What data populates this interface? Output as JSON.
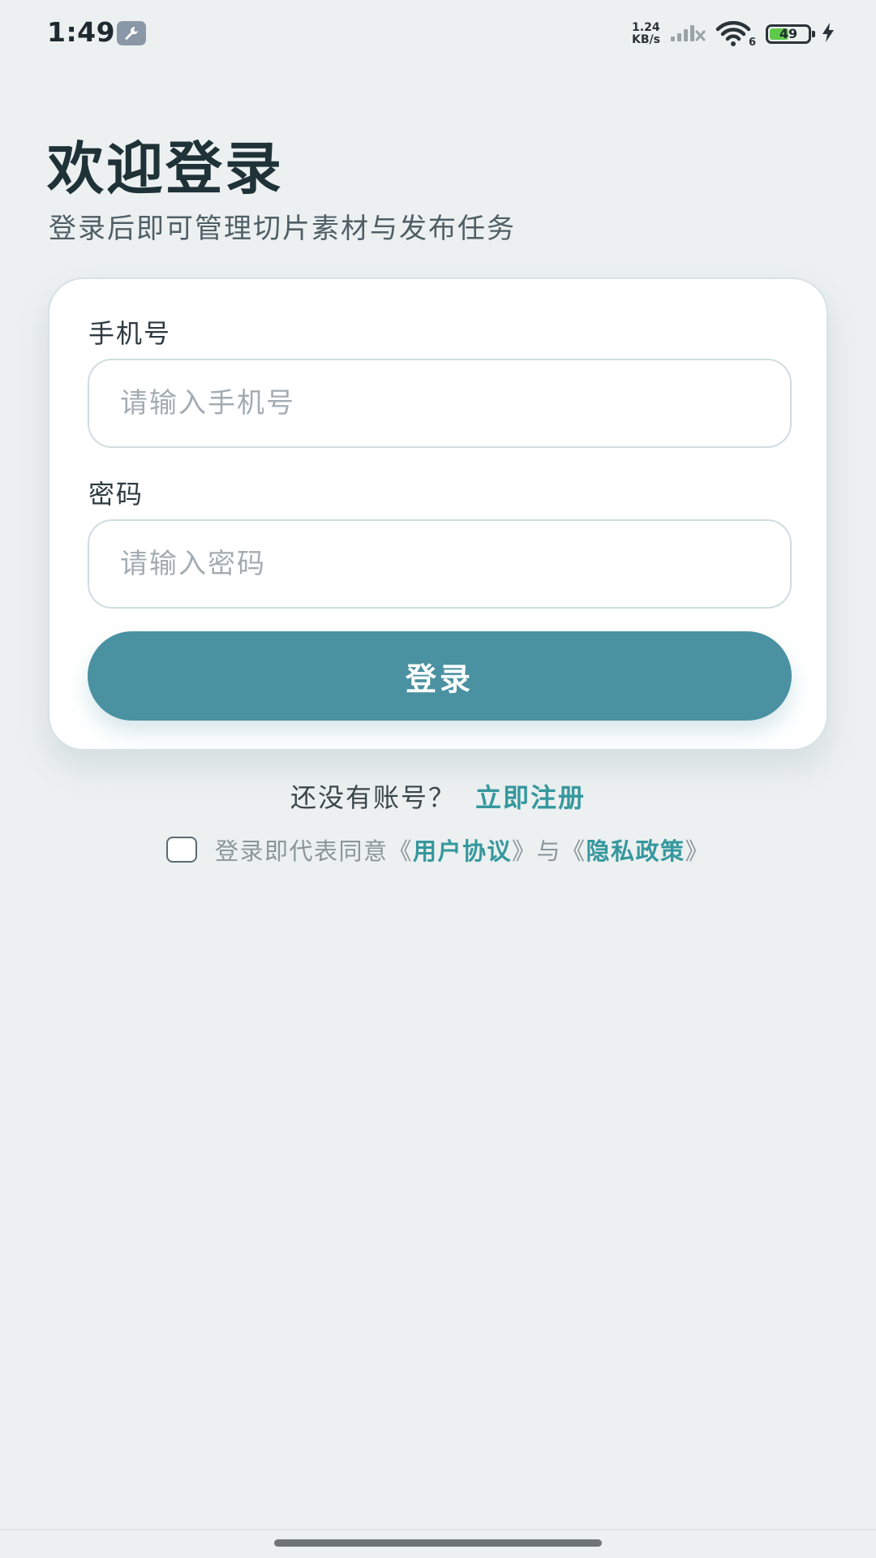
{
  "status_bar": {
    "time": "1:49",
    "net_speed_value": "1.24",
    "net_speed_unit": "KB/s",
    "wifi_label": "6",
    "battery_level": "49",
    "battery_fraction": 0.49
  },
  "header": {
    "title": "欢迎登录",
    "subtitle": "登录后即可管理切片素材与发布任务"
  },
  "form": {
    "phone_label": "手机号",
    "phone_placeholder": "请输入手机号",
    "password_label": "密码",
    "password_placeholder": "请输入密码",
    "submit_label": "登录"
  },
  "register": {
    "prompt": "还没有账号？",
    "link": "立即注册"
  },
  "agreement": {
    "prefix": "登录即代表同意《",
    "user_agreement": "用户协议",
    "middle": "》与《",
    "privacy_policy": "隐私政策",
    "suffix": "》"
  },
  "colors": {
    "background": "#ecf0f0",
    "accent": "#4a91a2",
    "link": "#35989e"
  }
}
